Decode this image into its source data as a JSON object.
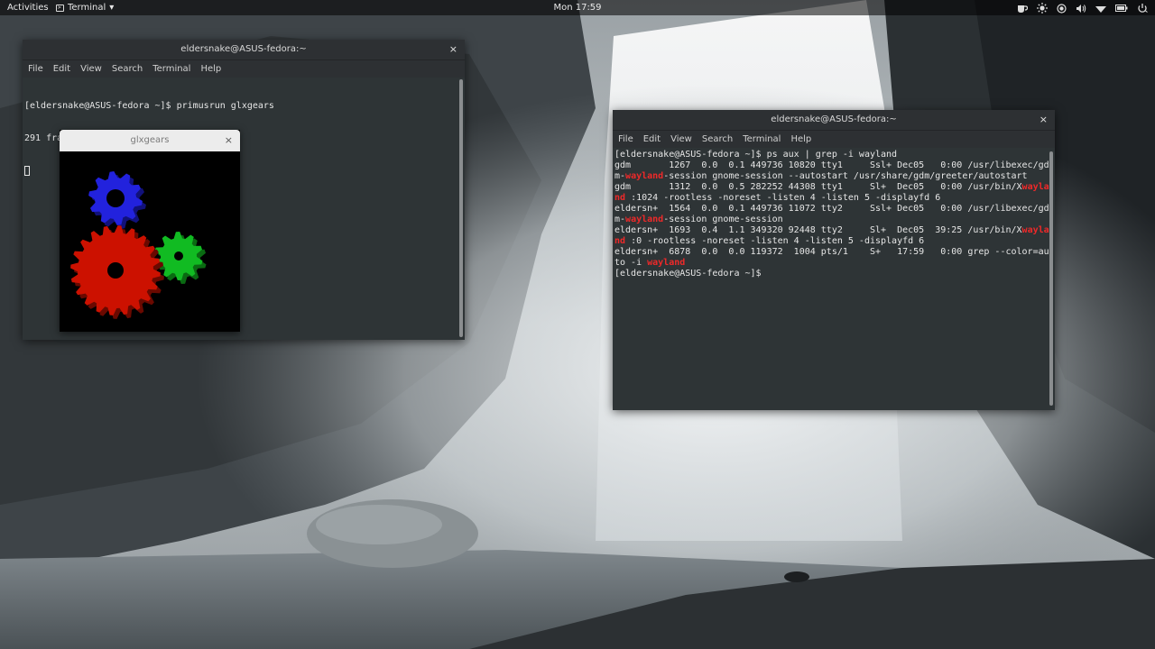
{
  "topbar": {
    "activities": "Activities",
    "app_menu": "Terminal",
    "app_menu_arrow": "▾",
    "clock": "Mon 17:59",
    "tray_icons": [
      "coffee-cup-icon",
      "brightness-icon",
      "record-icon",
      "volume-icon",
      "wifi-icon",
      "battery-icon",
      "power-icon"
    ]
  },
  "menus": [
    "File",
    "Edit",
    "View",
    "Search",
    "Terminal",
    "Help"
  ],
  "terminal_left": {
    "title": "eldersnake@ASUS-fedora:~",
    "close": "×",
    "lines": [
      "[eldersnake@ASUS-fedora ~]$ primusrun glxgears",
      "291 frames in 5.0 seconds = 58.026 FPS"
    ]
  },
  "glxgears": {
    "title": "glxgears",
    "close": "×"
  },
  "terminal_right": {
    "title": "eldersnake@ASUS-fedora:~",
    "close": "×",
    "lines": [
      [
        {
          "t": "[eldersnake@ASUS-fedora ~]$ ps aux | grep -i wayland"
        }
      ],
      [
        {
          "t": "gdm       1267  0.0  0.1 449736 10820 tty1     Ssl+ Dec05   0:00 /usr/libexec/gd"
        }
      ],
      [
        {
          "t": "m-"
        },
        {
          "t": "wayland",
          "hl": true
        },
        {
          "t": "-session gnome-session --autostart /usr/share/gdm/greeter/autostart"
        }
      ],
      [
        {
          "t": "gdm       1312  0.0  0.5 282252 44308 tty1     Sl+  Dec05   0:00 /usr/bin/X"
        },
        {
          "t": "wayla",
          "hl": true
        }
      ],
      [
        {
          "t": "nd",
          "hl": true
        },
        {
          "t": " :1024 -rootless -noreset -listen 4 -listen 5 -displayfd 6"
        }
      ],
      [
        {
          "t": "eldersn+  1564  0.0  0.1 449736 11072 tty2     Ssl+ Dec05   0:00 /usr/libexec/gd"
        }
      ],
      [
        {
          "t": "m-"
        },
        {
          "t": "wayland",
          "hl": true
        },
        {
          "t": "-session gnome-session"
        }
      ],
      [
        {
          "t": "eldersn+  1693  0.4  1.1 349320 92448 tty2     Sl+  Dec05  39:25 /usr/bin/X"
        },
        {
          "t": "wayla",
          "hl": true
        }
      ],
      [
        {
          "t": "nd",
          "hl": true
        },
        {
          "t": " :0 -rootless -noreset -listen 4 -listen 5 -displayfd 6"
        }
      ],
      [
        {
          "t": "eldersn+  6878  0.0  0.0 119372  1004 pts/1    S+   17:59   0:00 grep --color=au"
        }
      ],
      [
        {
          "t": "to -i "
        },
        {
          "t": "wayland",
          "hl": true
        }
      ],
      [
        {
          "t": "[eldersnake@ASUS-fedora ~]$ "
        }
      ]
    ]
  },
  "colors": {
    "terminal_bg": "#2e3436",
    "highlight": "#ef2929",
    "gear_red": "#cc1100",
    "gear_green": "#11bb22",
    "gear_blue": "#2222dd"
  }
}
